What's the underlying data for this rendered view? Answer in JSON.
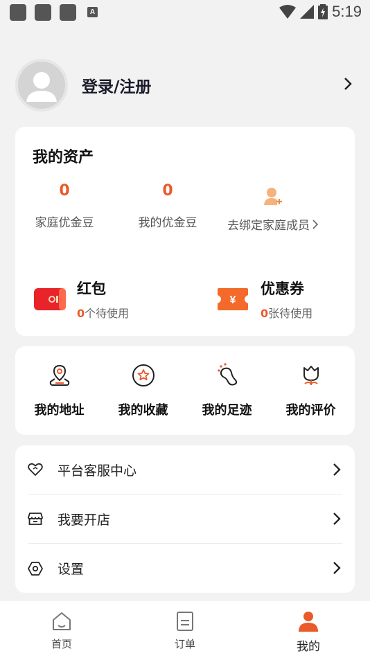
{
  "status_bar": {
    "time": "5:19",
    "a_icon_label": "A"
  },
  "profile": {
    "login_label": "登录/注册"
  },
  "assets": {
    "title": "我的资产",
    "family_beans": {
      "value": "0",
      "label": "家庭优金豆"
    },
    "my_beans": {
      "value": "0",
      "label": "我的优金豆"
    },
    "bind_family": {
      "label": "去绑定家庭成员"
    }
  },
  "wallet": {
    "red_packet": {
      "title": "红包",
      "count": "0",
      "suffix": "个待使用"
    },
    "coupon": {
      "title": "优惠券",
      "count": "0",
      "suffix": "张待使用"
    }
  },
  "quick_actions": [
    {
      "label": "我的地址",
      "icon": "address-pin-icon"
    },
    {
      "label": "我的收藏",
      "icon": "star-circle-icon"
    },
    {
      "label": "我的足迹",
      "icon": "footprint-icon"
    },
    {
      "label": "我的评价",
      "icon": "review-flower-icon"
    }
  ],
  "menu": [
    {
      "label": "平台客服中心",
      "icon": "heart-outline-icon"
    },
    {
      "label": "我要开店",
      "icon": "store-icon"
    },
    {
      "label": "设置",
      "icon": "settings-icon"
    }
  ],
  "tabbar": [
    {
      "label": "首页",
      "icon": "home-icon"
    },
    {
      "label": "订单",
      "icon": "order-icon"
    },
    {
      "label": "我的",
      "icon": "person-icon"
    }
  ],
  "colors": {
    "accent": "#ea5a2a",
    "accent_light": "#f5a773",
    "red_packet": "#e8232a",
    "coupon": "#f36a2b"
  }
}
